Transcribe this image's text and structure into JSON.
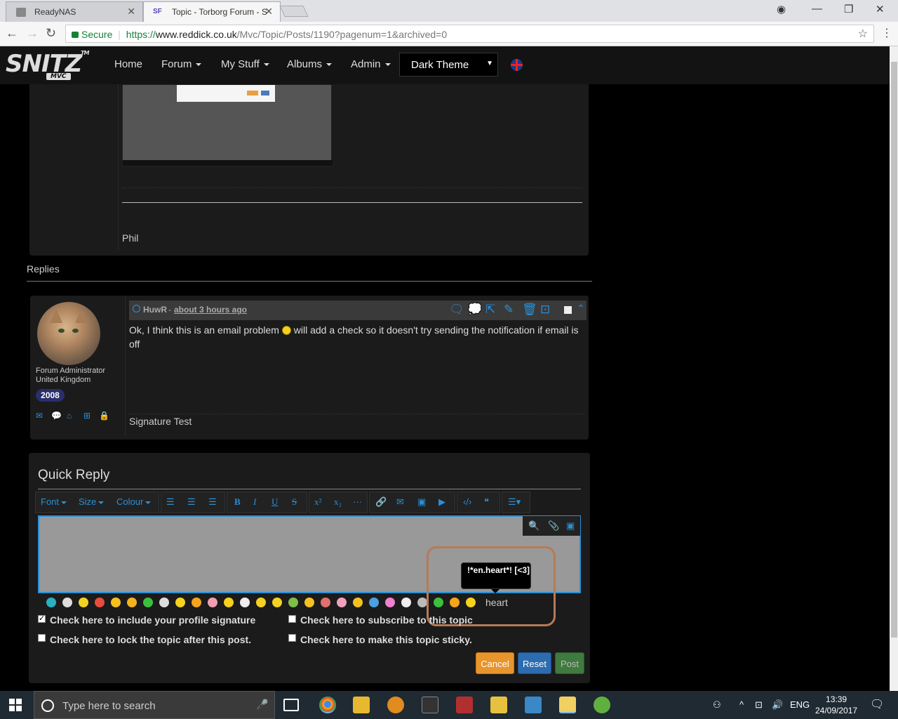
{
  "browser": {
    "tabs": [
      {
        "title": "ReadyNAS",
        "active": false
      },
      {
        "title": "Topic - Torborg Forum - S",
        "active": true
      }
    ],
    "secure_label": "Secure",
    "url_scheme": "https://",
    "url_host": "www.reddick.co.uk",
    "url_path": "/Mvc/Topic/Posts/1190?pagenum=1&archived=0"
  },
  "site": {
    "logo_text": "SNITZ",
    "logo_sub": "MVC",
    "logo_tm": "TM",
    "nav": [
      {
        "label": "Home",
        "dropdown": false
      },
      {
        "label": "Forum",
        "dropdown": true
      },
      {
        "label": "My Stuff",
        "dropdown": true
      },
      {
        "label": "Albums",
        "dropdown": true
      },
      {
        "label": "Admin",
        "dropdown": true
      }
    ],
    "theme_selected": "Dark Theme"
  },
  "original_post": {
    "signature": "Phil"
  },
  "replies": {
    "title": "Replies",
    "items": [
      {
        "author": "HuwR",
        "separator": " - ",
        "time": "about 3 hours ago",
        "role": "Forum Administrator",
        "country": "United Kingdom",
        "year_badge": "2008",
        "text_before": "Ok, I think this is an email problem ",
        "text_after": " will add a check so it doesn't try sending the notification if email is off",
        "signature": "Signature Test"
      }
    ]
  },
  "quick_reply": {
    "title": "Quick Reply",
    "toolbar": {
      "font": "Font",
      "size": "Size",
      "colour": "Colour",
      "bold": "B",
      "italic": "I",
      "underline": "U",
      "strike": "S",
      "superscript": "x²",
      "subscript": "x₂",
      "hr": "···"
    },
    "tooltip_text": "!*en.heart*! [<3]",
    "hover_label": "heart",
    "checkboxes": [
      {
        "label": "Check here to include your profile signature",
        "checked": true
      },
      {
        "label": "Check here to subscribe to this topic",
        "checked": false
      },
      {
        "label": "Check here to lock the topic after this post.",
        "checked": false
      },
      {
        "label": "Check here to make this topic sticky.",
        "checked": false
      }
    ],
    "buttons": {
      "cancel": "Cancel",
      "reset": "Reset",
      "post": "Post"
    }
  },
  "taskbar": {
    "search_placeholder": "Type here to search",
    "language": "ENG",
    "time": "13:39",
    "date": "24/09/2017"
  },
  "colors": {
    "accent": "#2a8fd6",
    "cancel": "#e8952c",
    "reset": "#2c6cb0",
    "post": "#3f7a3f",
    "highlight": "#b87a55"
  }
}
